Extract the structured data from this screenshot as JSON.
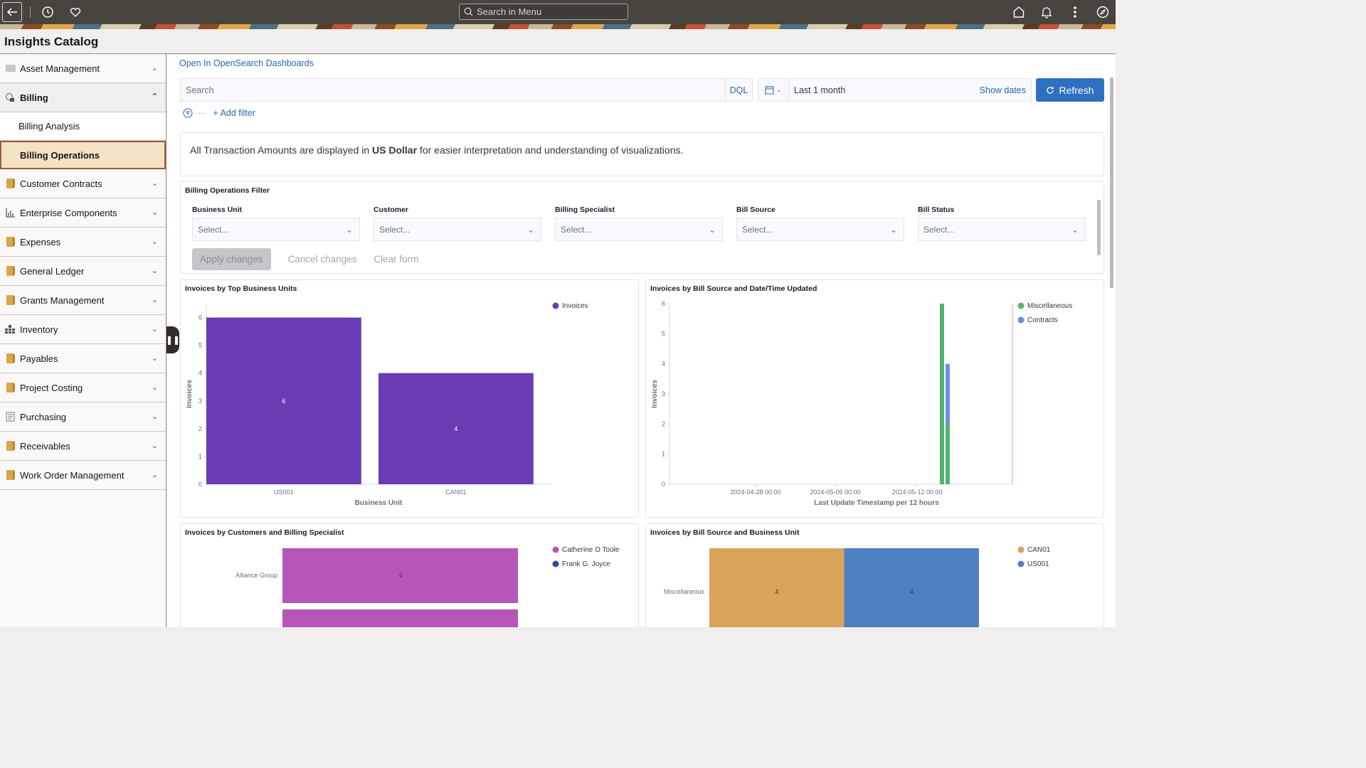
{
  "topbar": {
    "search_placeholder": "Search in Menu",
    "icons": [
      "back-arrow-icon",
      "history-icon",
      "favorites-heart-icon",
      "home-icon",
      "notification-bell-icon",
      "more-options-icon",
      "navigator-compass-icon"
    ]
  },
  "page": {
    "title": "Insights Catalog"
  },
  "sidebar": {
    "items": [
      {
        "label": "Asset Management",
        "icon": "asset-icon",
        "expanded": false
      },
      {
        "label": "Billing",
        "icon": "billing-icon",
        "expanded": true,
        "children": [
          {
            "label": "Billing Analysis",
            "active": false
          },
          {
            "label": "Billing Operations",
            "active": true
          }
        ]
      },
      {
        "label": "Customer Contracts",
        "icon": "folder-icon",
        "expanded": false
      },
      {
        "label": "Enterprise Components",
        "icon": "bar-chart-icon",
        "expanded": false
      },
      {
        "label": "Expenses",
        "icon": "folder-icon",
        "expanded": false
      },
      {
        "label": "General Ledger",
        "icon": "folder-icon",
        "expanded": false
      },
      {
        "label": "Grants Management",
        "icon": "folder-icon",
        "expanded": false
      },
      {
        "label": "Inventory",
        "icon": "inventory-icon",
        "expanded": false
      },
      {
        "label": "Payables",
        "icon": "folder-icon",
        "expanded": false
      },
      {
        "label": "Project Costing",
        "icon": "folder-icon",
        "expanded": false
      },
      {
        "label": "Purchasing",
        "icon": "purchasing-icon",
        "expanded": false
      },
      {
        "label": "Receivables",
        "icon": "folder-icon",
        "expanded": false
      },
      {
        "label": "Work Order Management",
        "icon": "folder-icon",
        "expanded": false
      }
    ]
  },
  "main": {
    "open_link": "Open In OpenSearch Dashboards",
    "query": {
      "placeholder": "Search",
      "language": "DQL"
    },
    "date": {
      "range": "Last 1 month",
      "show_dates": "Show dates"
    },
    "refresh_label": "Refresh",
    "add_filter": "+ Add filter",
    "note": {
      "prefix": "All Transaction Amounts are displayed in ",
      "bold": "US Dollar",
      "suffix": " for easier interpretation and understanding of visualizations."
    },
    "filter_panel": {
      "title": "Billing Operations Filter",
      "fields": [
        {
          "label": "Business Unit",
          "value": "Select..."
        },
        {
          "label": "Customer",
          "value": "Select..."
        },
        {
          "label": "Billing Specialist",
          "value": "Select..."
        },
        {
          "label": "Bill Source",
          "value": "Select..."
        },
        {
          "label": "Bill Status",
          "value": "Select..."
        }
      ],
      "apply": "Apply changes",
      "cancel": "Cancel changes",
      "clear": "Clear form"
    }
  },
  "chart_data": [
    {
      "type": "bar",
      "title": "Invoices by Top Business Units",
      "categories": [
        "US001",
        "CAN01"
      ],
      "values": [
        6,
        4
      ],
      "xlabel": "Business Unit",
      "ylabel": "Invoices",
      "ylim": [
        0,
        6.5
      ],
      "yticks": [
        0,
        1,
        2,
        3,
        4,
        5,
        6
      ],
      "legend": [
        {
          "name": "Invoices",
          "color": "#6a3cb4"
        }
      ],
      "legend_position": "top-right",
      "color": "#6a3cb4"
    },
    {
      "type": "bar",
      "title": "Invoices by Bill Source and Date/Time Updated",
      "xlabel": "Last Update Timestamp per 12 hours",
      "ylabel": "Invoices",
      "ylim": [
        0,
        6
      ],
      "yticks": [
        0,
        1,
        2,
        3,
        4,
        5,
        6
      ],
      "xticks": [
        "2024-04-28 00:00",
        "2024-05-05 00:00",
        "2024-05-12 00:00"
      ],
      "series": [
        {
          "name": "Miscellaneous",
          "color": "#54b373",
          "values": [
            6
          ]
        },
        {
          "name": "Contracts",
          "color": "#6b8fe0",
          "values": [
            4
          ],
          "stacked_segment": {
            "Miscellaneous": 2,
            "Contracts": 2
          }
        }
      ],
      "legend_position": "top-right"
    },
    {
      "type": "bar",
      "orientation": "horizontal",
      "title": "Invoices by Customers and Billing Specialist",
      "categories": [
        "Alliance Group"
      ],
      "series": [
        {
          "name": "Catherine O Toole",
          "color": "#b556b8",
          "values": [
            4
          ]
        },
        {
          "name": "Frank G. Joyce",
          "color": "#2c4a9a",
          "values": []
        }
      ],
      "legend_position": "top-right"
    },
    {
      "type": "bar",
      "orientation": "horizontal",
      "stacked": true,
      "title": "Invoices by Bill Source and Business Unit",
      "categories": [
        "Miscellaneous"
      ],
      "series": [
        {
          "name": "CAN01",
          "color": "#d9a35a",
          "values": [
            4
          ]
        },
        {
          "name": "US001",
          "color": "#4f7fc0",
          "values": [
            4
          ]
        }
      ],
      "legend_position": "top-right"
    }
  ]
}
